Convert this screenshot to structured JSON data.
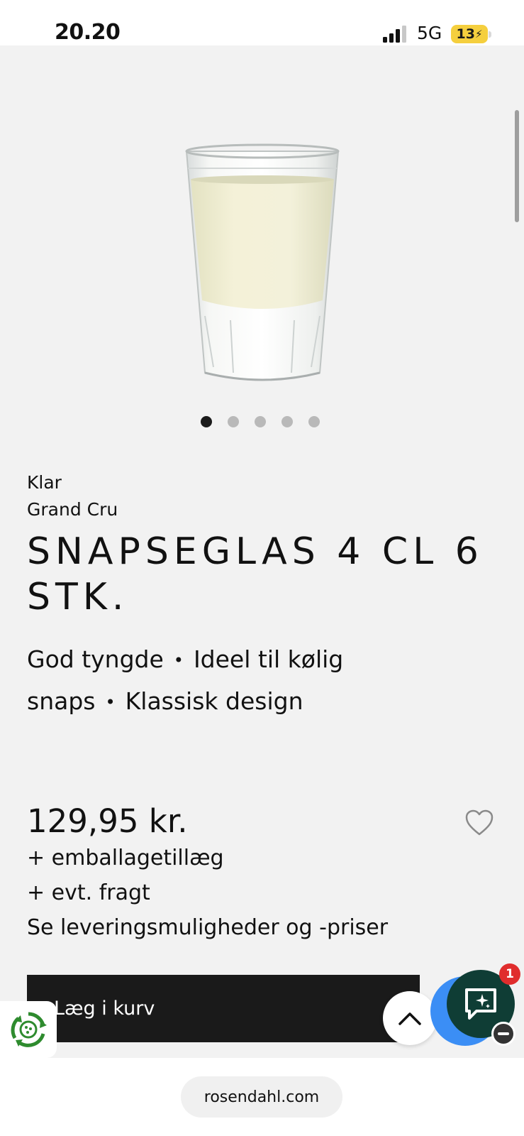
{
  "status_bar": {
    "time": "20.20",
    "network": "5G",
    "battery": "13"
  },
  "gallery": {
    "image_icon": "shot-glass-product-photo",
    "slide_count": 5,
    "active_slide": 1
  },
  "product": {
    "color": "Klar",
    "series": "Grand Cru",
    "title": "SNAPSEGLAS 4 CL 6 STK.",
    "features": [
      "God tyngde",
      "Ideel til kølig snaps",
      "Klassisk design"
    ],
    "price": "129,95 kr.",
    "packaging_note": "+ emballagetillæg",
    "shipping_note": "+ evt. fragt",
    "delivery_link": "Se leveringsmuligheder og -priser"
  },
  "actions": {
    "add_to_cart": "Læg i kurv",
    "chat_badge_count": "1"
  },
  "browser": {
    "url": "rosendahl.com"
  },
  "colors": {
    "background": "#f2f2f2",
    "button": "#1a1a1a",
    "chat": "#0f3d35",
    "chat_accent": "#3b8ef5",
    "badge": "#e02d2d",
    "battery": "#f5cf3e"
  }
}
